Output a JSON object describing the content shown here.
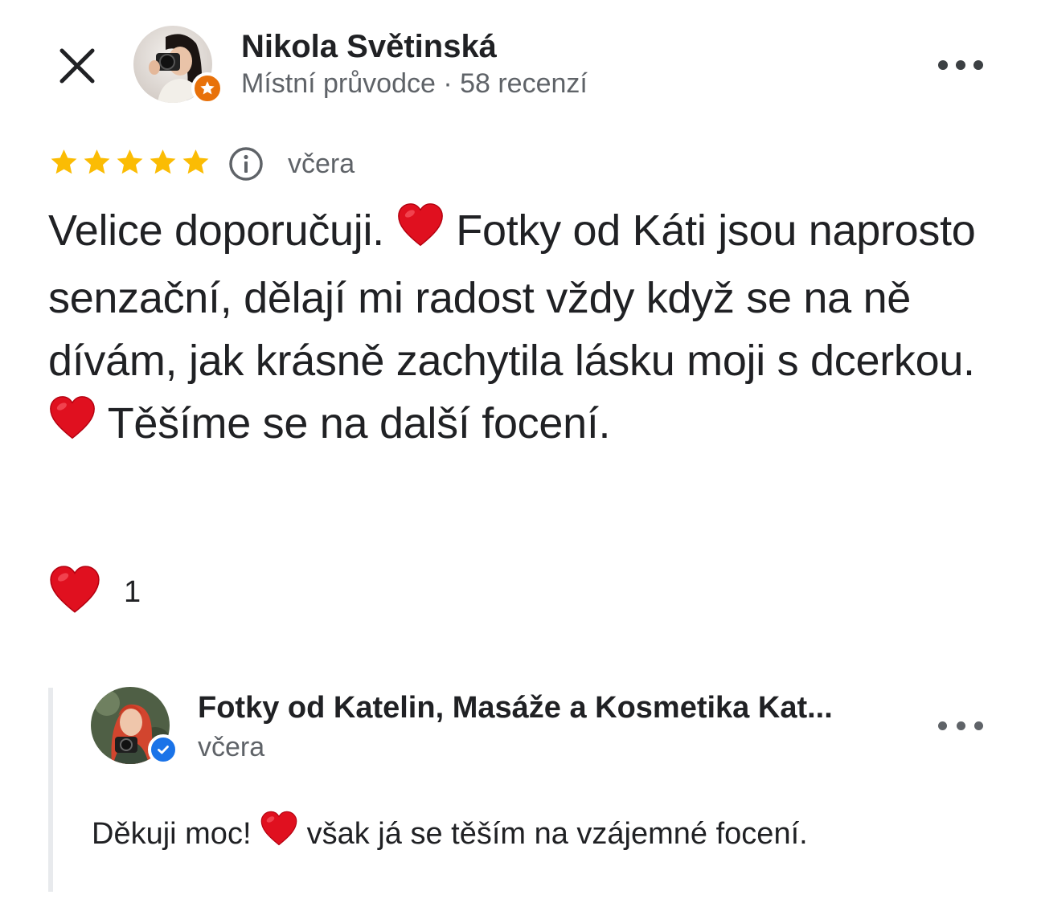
{
  "header": {
    "close_icon": "close-icon",
    "reviewer_name": "Nikola Světinská",
    "reviewer_meta": "Místní průvodce · 58 recenzí",
    "badge_icon": "local-guide-star-icon",
    "badge_color": "#e8710a",
    "more_icon": "more-horizontal-icon"
  },
  "rating": {
    "stars": 5,
    "max_stars": 5,
    "star_color": "#fbbc04",
    "info_icon": "info-icon",
    "date": "včera"
  },
  "review": {
    "parts": [
      "Velice doporučuji. ",
      " Fotky od Káti jsou naprosto senzační, dělají mi radost vždy když se na ně dívám, jak krásně zachytila lásku moji s dcerkou. ",
      " Těšíme se na další focení."
    ],
    "emoji_icon": "red-heart-icon"
  },
  "reaction": {
    "icon": "red-heart-icon",
    "count": "1"
  },
  "reply": {
    "owner_name": "Fotky od Katelin, Masáže a Kosmetika Kat...",
    "date": "včera",
    "verified_icon": "verified-check-icon",
    "verified_color": "#1a73e8",
    "parts": [
      "Děkuji moc! ",
      " však já se těším na vzájemné focení."
    ]
  }
}
